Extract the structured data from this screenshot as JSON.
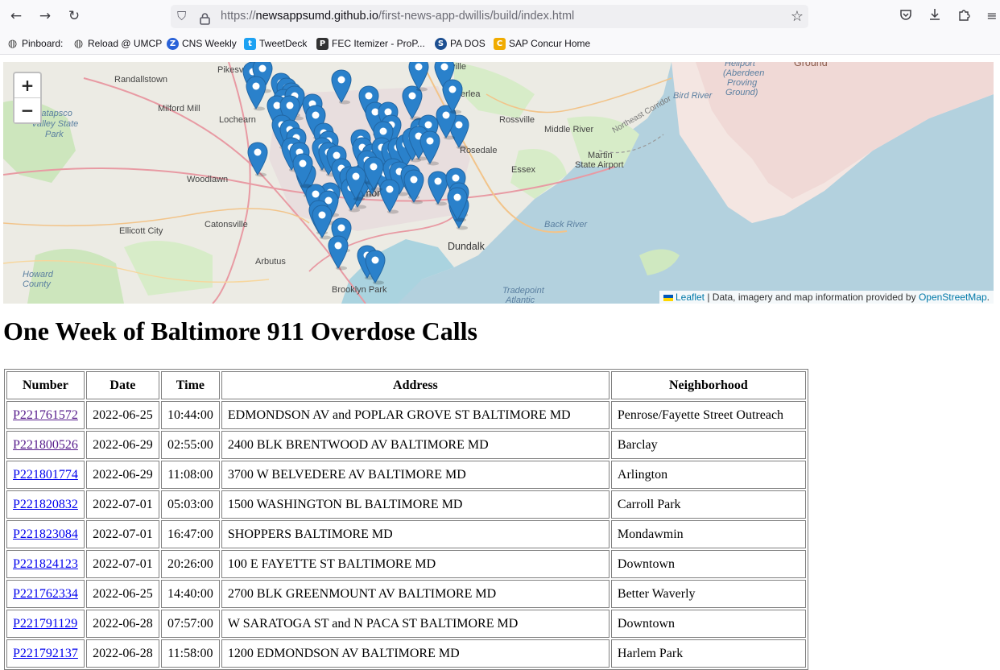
{
  "browser": {
    "url_prefix": "https://",
    "url_host": "newsappsumd.github.io",
    "url_path": "/first-news-app-dwillis/build/index.html",
    "bookmarks": [
      {
        "label": "Pinboard:",
        "icon": "globe-icon"
      },
      {
        "label": "Reload @ UMCP",
        "icon": "globe-icon"
      },
      {
        "label": "CNS Weekly",
        "icon": "z-logo-icon"
      },
      {
        "label": "TweetDeck",
        "icon": "tweetdeck-icon"
      },
      {
        "label": "FEC Itemizer - ProP...",
        "icon": "propublica-icon"
      },
      {
        "label": "PA DOS",
        "icon": "pa-dos-icon"
      },
      {
        "label": "SAP Concur Home",
        "icon": "concur-icon"
      }
    ]
  },
  "map": {
    "zoom_in": "+",
    "zoom_out": "−",
    "attribution_leaflet": "Leaflet",
    "attribution_text": " | Data, imagery and map information provided by ",
    "attribution_osm": "OpenStreetMap",
    "attribution_end": ".",
    "places": {
      "randallstown": "Randallstown",
      "pikesville": "Pikesv",
      "milford_mill": "Milford Mill",
      "patapsco": "Patapsco",
      "valley_state": "Valley State",
      "park": "Park",
      "lochearn": "Lochearn",
      "woodlawn": "Woodlawn",
      "catonsville": "Catonsville",
      "ellicott_city": "Ellicott City",
      "arbutus": "Arbutus",
      "howard": "Howard",
      "county": "County",
      "brooklyn_park": "Brooklyn Park",
      "dundalk": "Dundalk",
      "essex": "Essex",
      "rosedale": "Rosedale",
      "rossville": "Rossville",
      "middle_river": "Middle River",
      "martin": "Martin",
      "state_airport": "State Airport",
      "bird_river": "Bird River",
      "back_river": "Back River",
      "parkville": "ville",
      "overlea": "erlea",
      "baltimore": "imor",
      "aberdeen1": "Heliport",
      "aberdeen2": "(Aberdeen",
      "aberdeen3": "Proving",
      "aberdeen4": "Ground)",
      "ground": "Ground",
      "northeast_corridor": "Northeast Corridor",
      "tradepoint": "Tradepoint",
      "atlantic": "Atlantic"
    }
  },
  "page": {
    "title": "One Week of Baltimore 911 Overdose Calls"
  },
  "table": {
    "headers": [
      "Number",
      "Date",
      "Time",
      "Address",
      "Neighborhood"
    ],
    "rows": [
      {
        "number": "P221761572",
        "date": "2022-06-25",
        "time": "10:44:00",
        "address": "EDMONDSON AV and POPLAR GROVE ST BALTIMORE MD",
        "neighborhood": "Penrose/Fayette Street Outreach",
        "visited": true
      },
      {
        "number": "P221800526",
        "date": "2022-06-29",
        "time": "02:55:00",
        "address": "2400 BLK BRENTWOOD AV BALTIMORE MD",
        "neighborhood": "Barclay",
        "visited": true
      },
      {
        "number": "P221801774",
        "date": "2022-06-29",
        "time": "11:08:00",
        "address": "3700 W BELVEDERE AV BALTIMORE MD",
        "neighborhood": "Arlington",
        "visited": false
      },
      {
        "number": "P221820832",
        "date": "2022-07-01",
        "time": "05:03:00",
        "address": "1500 WASHINGTON BL BALTIMORE MD",
        "neighborhood": "Carroll Park",
        "visited": false
      },
      {
        "number": "P221823084",
        "date": "2022-07-01",
        "time": "16:47:00",
        "address": "SHOPPERS BALTIMORE MD",
        "neighborhood": "Mondawmin",
        "visited": false
      },
      {
        "number": "P221824123",
        "date": "2022-07-01",
        "time": "20:26:00",
        "address": "100 E FAYETTE ST BALTIMORE MD",
        "neighborhood": "Downtown",
        "visited": false
      },
      {
        "number": "P221762334",
        "date": "2022-06-25",
        "time": "14:40:00",
        "address": "2700 BLK GREENMOUNT AV BALTIMORE MD",
        "neighborhood": "Better Waverly",
        "visited": false
      },
      {
        "number": "P221791129",
        "date": "2022-06-28",
        "time": "07:57:00",
        "address": "W SARATOGA ST and N PACA ST BALTIMORE MD",
        "neighborhood": "Downtown",
        "visited": false
      },
      {
        "number": "P221792137",
        "date": "2022-06-28",
        "time": "11:58:00",
        "address": "1200 EDMONDSON AV BALTIMORE MD",
        "neighborhood": "Harlem Park",
        "visited": false
      }
    ]
  }
}
